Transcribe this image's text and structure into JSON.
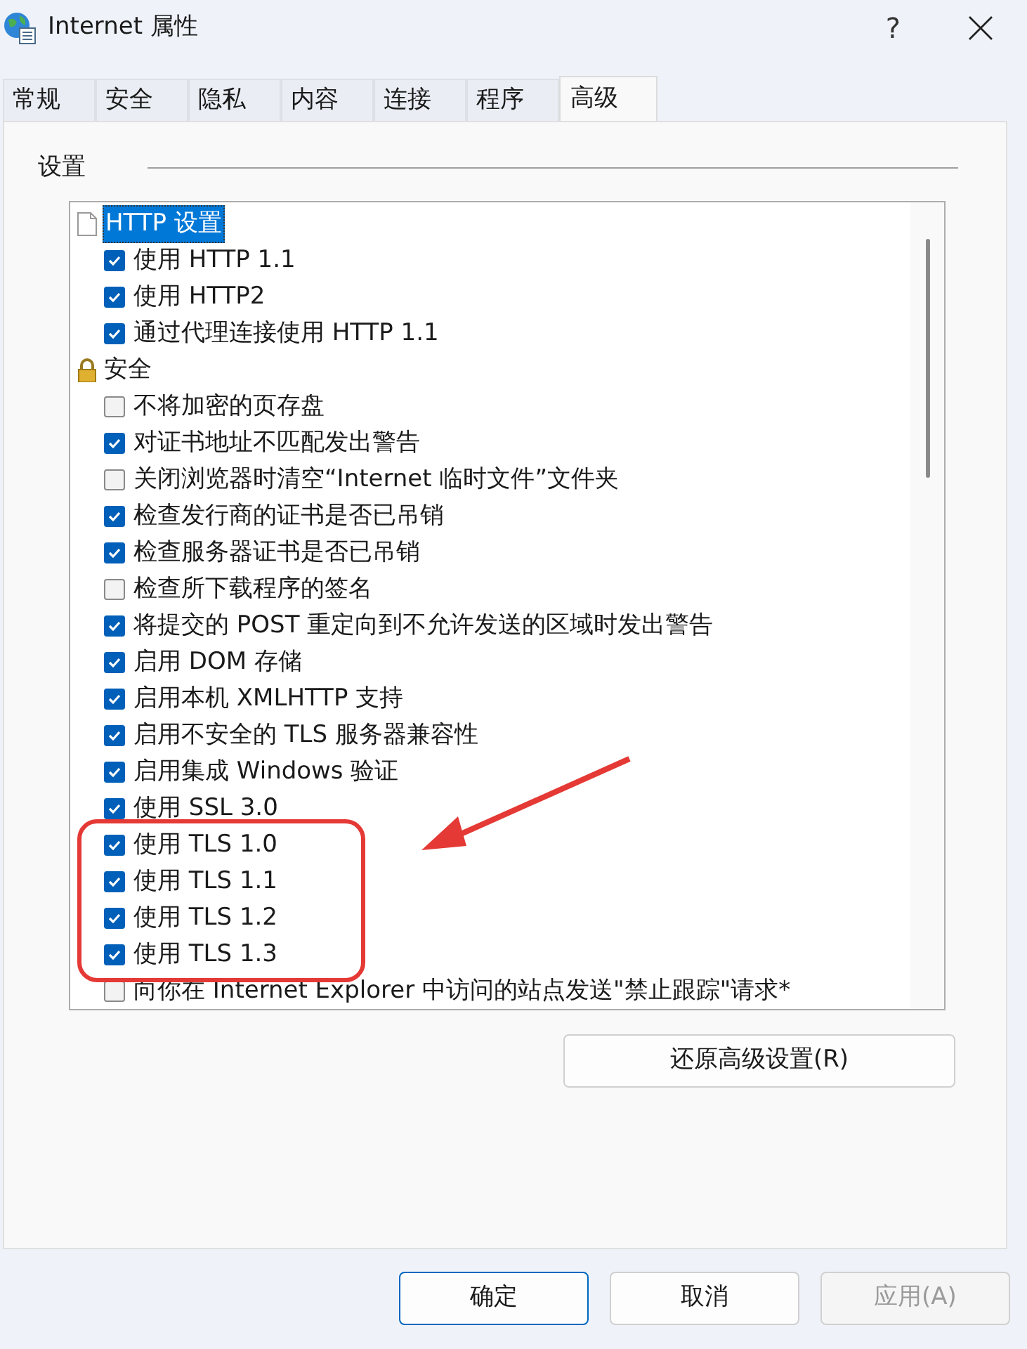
{
  "window": {
    "title": "Internet 属性",
    "help": "?"
  },
  "tabs": [
    {
      "label": "常规",
      "selected": false
    },
    {
      "label": "安全",
      "selected": false
    },
    {
      "label": "隐私",
      "selected": false
    },
    {
      "label": "内容",
      "selected": false
    },
    {
      "label": "连接",
      "selected": false
    },
    {
      "label": "程序",
      "selected": false
    },
    {
      "label": "高级",
      "selected": true
    }
  ],
  "group": {
    "label": "设置"
  },
  "settings": [
    {
      "kind": "category",
      "label": "HTTP 设置",
      "selected": true
    },
    {
      "kind": "checkbox",
      "label": "使用 HTTP 1.1",
      "checked": true,
      "selected": false
    },
    {
      "kind": "checkbox",
      "label": "使用 HTTP2",
      "checked": true,
      "selected": false
    },
    {
      "kind": "checkbox",
      "label": "通过代理连接使用 HTTP 1.1",
      "checked": true,
      "selected": false
    },
    {
      "kind": "category",
      "label": "安全",
      "selected": false
    },
    {
      "kind": "checkbox",
      "label": "不将加密的页存盘",
      "checked": false,
      "selected": false
    },
    {
      "kind": "checkbox",
      "label": "对证书地址不匹配发出警告",
      "checked": true,
      "selected": false
    },
    {
      "kind": "checkbox",
      "label": "关闭浏览器时清空“Internet 临时文件”文件夹",
      "checked": false,
      "selected": false
    },
    {
      "kind": "checkbox",
      "label": "检查发行商的证书是否已吊销",
      "checked": true,
      "selected": false
    },
    {
      "kind": "checkbox",
      "label": "检查服务器证书是否已吊销",
      "checked": true,
      "selected": false
    },
    {
      "kind": "checkbox",
      "label": "检查所下载程序的签名",
      "checked": false,
      "selected": false
    },
    {
      "kind": "checkbox",
      "label": "将提交的 POST 重定向到不允许发送的区域时发出警告",
      "checked": true,
      "selected": false
    },
    {
      "kind": "checkbox",
      "label": "启用 DOM 存储",
      "checked": true,
      "selected": false
    },
    {
      "kind": "checkbox",
      "label": "启用本机 XMLHTTP 支持",
      "checked": true,
      "selected": false
    },
    {
      "kind": "checkbox",
      "label": "启用不安全的 TLS 服务器兼容性",
      "checked": true,
      "selected": false
    },
    {
      "kind": "checkbox",
      "label": "启用集成 Windows 验证",
      "checked": true,
      "selected": false
    },
    {
      "kind": "checkbox",
      "label": "使用 SSL 3.0",
      "checked": true,
      "selected": false
    },
    {
      "kind": "checkbox",
      "label": "使用 TLS 1.0",
      "checked": true,
      "selected": false
    },
    {
      "kind": "checkbox",
      "label": "使用 TLS 1.1",
      "checked": true,
      "selected": false
    },
    {
      "kind": "checkbox",
      "label": "使用 TLS 1.2",
      "checked": true,
      "selected": false
    },
    {
      "kind": "checkbox",
      "label": "使用 TLS 1.3",
      "checked": true,
      "selected": false
    },
    {
      "kind": "checkbox",
      "label": "向你在 Internet Explorer 中访问的站点发送\"禁止跟踪\"请求*",
      "checked": false,
      "selected": false
    }
  ],
  "reset_button": {
    "label": "还原高级设置(R)"
  },
  "buttons": [
    {
      "label": "确定",
      "kind": "default",
      "disabled": false
    },
    {
      "label": "取消",
      "kind": "normal",
      "disabled": false
    },
    {
      "label": "应用(A)",
      "kind": "normal",
      "disabled": true
    }
  ]
}
